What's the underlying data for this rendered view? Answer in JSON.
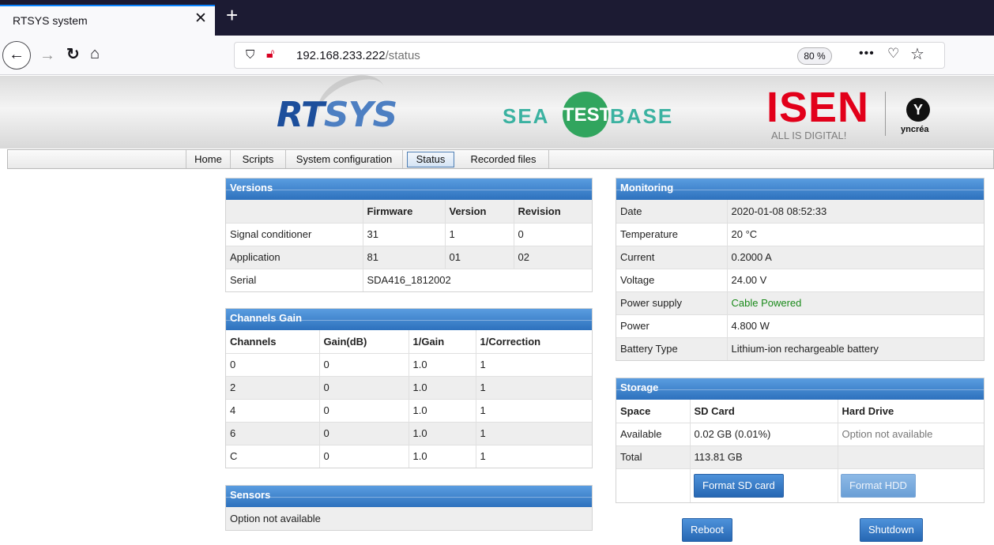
{
  "browser": {
    "tab_title": "RTSYS system",
    "tab_close": "✕",
    "new_tab": "+",
    "url_host": "192.168.233.222",
    "url_path": "/status",
    "zoom": "80 %",
    "more": "•••"
  },
  "banner": {
    "rtsys_r": "RT",
    "rtsys_s": "SYS",
    "sea": "SEA",
    "test": "TEST",
    "base": "BASE",
    "isen": "ISEN",
    "isen_tag": "ALL IS DIGITAL!",
    "yncrea_y": "Y",
    "yncrea": "yncréa"
  },
  "menu": {
    "home": "Home",
    "scripts": "Scripts",
    "system_configuration": "System configuration",
    "status": "Status",
    "recorded_files": "Recorded files"
  },
  "versions": {
    "title": "Versions",
    "headers": [
      "",
      "Firmware",
      "Version",
      "Revision"
    ],
    "rows": [
      [
        "Signal conditioner",
        "31",
        "1",
        "0"
      ],
      [
        "Application",
        "81",
        "01",
        "02"
      ],
      [
        "Serial",
        "SDA416_1812002"
      ]
    ]
  },
  "channels_gain": {
    "title": "Channels Gain",
    "headers": [
      "Channels",
      "Gain(dB)",
      "1/Gain",
      "1/Correction"
    ],
    "rows": [
      [
        "0",
        "0",
        "1.0",
        "1"
      ],
      [
        "2",
        "0",
        "1.0",
        "1"
      ],
      [
        "4",
        "0",
        "1.0",
        "1"
      ],
      [
        "6",
        "0",
        "1.0",
        "1"
      ],
      [
        "C",
        "0",
        "1.0",
        "1"
      ]
    ]
  },
  "sensors": {
    "title": "Sensors",
    "message": "Option not available"
  },
  "monitoring": {
    "title": "Monitoring",
    "rows": [
      [
        "Date",
        "2020-01-08 08:52:33"
      ],
      [
        "Temperature",
        "20 °C"
      ],
      [
        "Current",
        "0.2000 A"
      ],
      [
        "Voltage",
        "24.00 V"
      ],
      [
        "Power supply",
        "Cable Powered"
      ],
      [
        "Power",
        "4.800 W"
      ],
      [
        "Battery Type",
        "Lithium-ion rechargeable battery"
      ]
    ],
    "power_supply_color": "#1a8a1a"
  },
  "storage": {
    "title": "Storage",
    "headers": [
      "Space",
      "SD Card",
      "Hard Drive"
    ],
    "rows": [
      [
        "Available",
        "0.02 GB (0.01%)",
        "Option not available"
      ],
      [
        "Total",
        "113.81 GB",
        ""
      ]
    ],
    "format_sd": "Format SD card",
    "format_hdd": "Format HDD"
  },
  "actions": {
    "reboot": "Reboot",
    "shutdown": "Shutdown"
  },
  "colors": {
    "panel_header": "#2d71bd",
    "browser_frame": "#1c1b33"
  }
}
